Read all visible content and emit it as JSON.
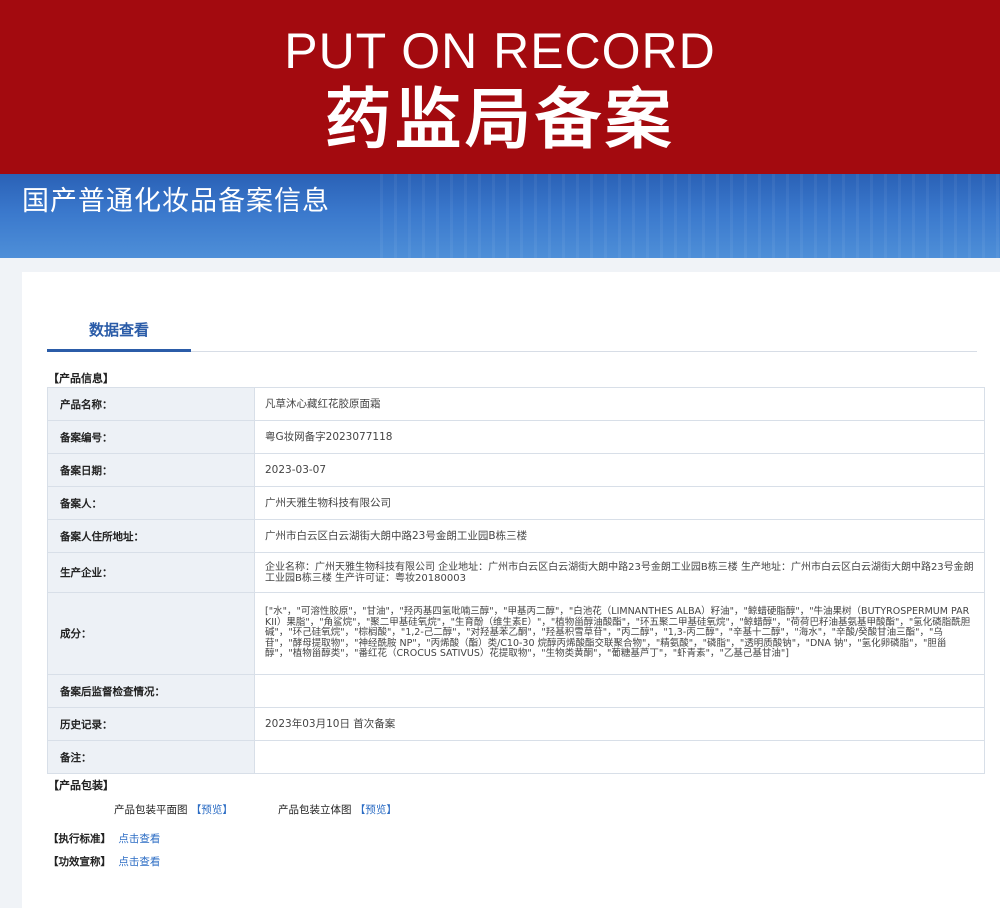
{
  "banner": {
    "en": "PUT ON RECORD",
    "zh": "药监局备案"
  },
  "hero": {
    "title": "国产普通化妆品备案信息"
  },
  "tab": {
    "label": "数据查看"
  },
  "product_info": {
    "heading": "【产品信息】",
    "rows": [
      {
        "key": "产品名称：",
        "value": "凡草沐心藏红花胶原面霜"
      },
      {
        "key": "备案编号：",
        "value": "粤G妆网备字2023077118"
      },
      {
        "key": "备案日期：",
        "value": "2023-03-07"
      },
      {
        "key": "备案人：",
        "value": "广州天雅生物科技有限公司"
      },
      {
        "key": "备案人住所地址：",
        "value": "广州市白云区白云湖街大朗中路23号金朗工业园B栋三楼"
      },
      {
        "key": "生产企业：",
        "value": "企业名称：广州天雅生物科技有限公司 企业地址：广州市白云区白云湖街大朗中路23号金朗工业园B栋三楼 生产地址：广州市白云区白云湖街大朗中路23号金朗工业园B栋三楼 生产许可证：粤妆20180003"
      },
      {
        "key": "成分：",
        "value": "[\"水\"，\"可溶性胶原\"，\"甘油\"，\"羟丙基四氢吡喃三醇\"，\"甲基丙二醇\"，\"白池花（LIMNANTHES ALBA）籽油\"，\"鲸蜡硬脂醇\"，\"牛油果树（BUTYROSPERMUM PARKII）果脂\"，\"角鲨烷\"，\"聚二甲基硅氧烷\"，\"生育酚（维生素E）\"，\"植物甾醇油酸酯\"，\"环五聚二甲基硅氧烷\"，\"鲸蜡醇\"，\"荷荷巴籽油基氨基甲酸酯\"，\"氢化磷脂酰胆碱\"，\"环己硅氧烷\"，\"棕榈酸\"，\"1,2-己二醇\"，\"对羟基苯乙酮\"，\"羟基积雪草苷\"，\"丙二醇\"，\"1,3-丙二醇\"，\"辛基十二醇\"，\"海水\"，\"辛酸/癸酸甘油三酯\"，\"乌苷\"，\"酵母提取物\"，\"神经酰胺 NP\"，\"丙烯酸（酯）类/C10-30 烷醇丙烯酸酯交联聚合物\"，\"精氨酸\"，\"磷脂\"，\"透明质酸钠\"，\"DNA 钠\"，\"氢化卵磷脂\"，\"胆甾醇\"，\"植物甾醇类\"，\"番红花（CROCUS SATIVUS）花提取物\"，\"生物类黄酮\"，\"葡糖基芦丁\"，\"虾青素\"，\"乙基己基甘油\"]"
      },
      {
        "key": "备案后监督检查情况：",
        "value": ""
      },
      {
        "key": "历史记录：",
        "value": "2023年03月10日 首次备案"
      },
      {
        "key": "备注：",
        "value": ""
      }
    ]
  },
  "packaging": {
    "heading": "【产品包装】",
    "flat_label": "产品包装平面图",
    "flat_link": "【预览】",
    "solid_label": "产品包装立体图",
    "solid_link": "【预览】"
  },
  "standard": {
    "label": "【执行标准】",
    "link": "点击查看"
  },
  "efficacy": {
    "label": "【功效宣称】",
    "link": "点击查看"
  },
  "colors": {
    "banner": "#a30a0f",
    "hero": "#2a61b6",
    "tab": "#2b5ca8",
    "link": "#2b6cc4"
  }
}
